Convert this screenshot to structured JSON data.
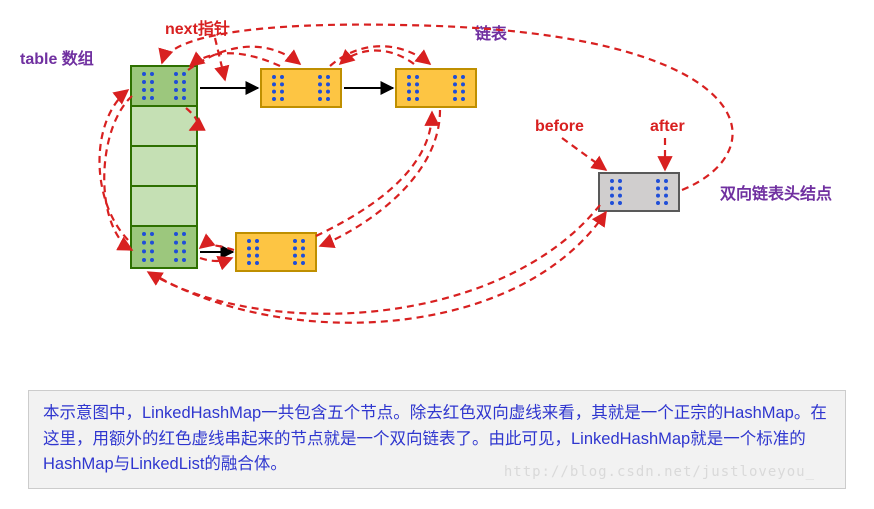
{
  "labels": {
    "table_array": "table 数组",
    "next_pointer": "next指针",
    "linked_list": "链表",
    "before": "before",
    "after": "after",
    "dll_head": "双向链表头结点"
  },
  "caption": "本示意图中，LinkedHashMap一共包含五个节点。除去红色双向虚线来看，其就是一个正宗的HashMap。在这里，用额外的红色虚线串起来的节点就是一个双向链表了。由此可见，LinkedHashMap就是一个标准的HashMap与LinkedList的融合体。",
  "watermark": "http://blog.csdn.net/justloveyou_",
  "chart_data": {
    "type": "diagram",
    "description": "LinkedHashMap internal structure",
    "table_array_slots": 5,
    "linked_nodes": 5,
    "elements": [
      {
        "id": "t0",
        "slot": 0,
        "role": "bucket"
      },
      {
        "id": "t4",
        "slot": 4,
        "role": "bucket"
      },
      {
        "id": "n1",
        "role": "list-node",
        "from": "t0"
      },
      {
        "id": "n2",
        "role": "list-node",
        "from": "n1"
      },
      {
        "id": "n3",
        "role": "list-node",
        "from": "t4"
      },
      {
        "id": "head",
        "role": "dll-head"
      }
    ],
    "next_edges": [
      [
        "t0",
        "n1"
      ],
      [
        "n1",
        "n2"
      ],
      [
        "t4",
        "n3"
      ]
    ],
    "dll_edges_note": "red dashed arrows form doubly-linked cycle through head and all five nodes"
  }
}
